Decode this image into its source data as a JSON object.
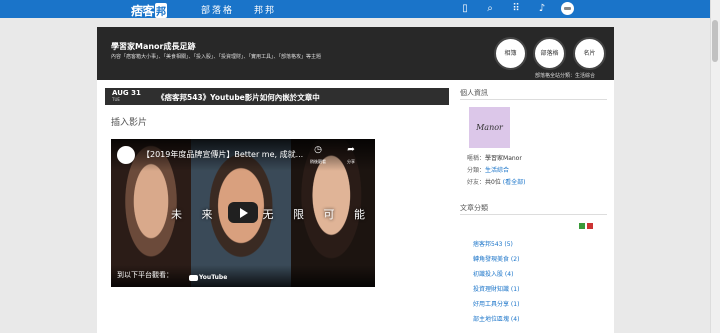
{
  "topbar": {
    "logo_text": "痞客",
    "logo_box": "邦",
    "nav": [
      "部落格",
      "邦邦"
    ]
  },
  "header": {
    "title": "學習家Manor成長足跡",
    "description": "內容「痞客箱大小事」、「美食相關」、「投入股」、「投資理財」、「實用工具」、「部落格攻」等主題",
    "buttons": [
      "相簿",
      "部落格",
      "名片"
    ],
    "category_line": "部落格全站分類：生活綜合"
  },
  "post": {
    "month_day": "AUG 31",
    "weekday": "TUE",
    "title": "《痞客邦543》Youtube影片如何內嵌於文章中",
    "section_heading": "插入影片"
  },
  "video": {
    "title": "【2019年度品牌宣傳片】Better me, 成就...",
    "subtitle": "未 来 我   无 限 可 能",
    "watch_text": "到以下平台觀看：",
    "youtube_label": "YouTube",
    "action_labels": [
      "稍後觀看",
      "分享"
    ]
  },
  "sidebar": {
    "profile_heading": "個人資訊",
    "profile_image_text": "Manor",
    "nickname_label": "暱稱：",
    "nickname": "學習家Manor",
    "category_label": "分類：",
    "category": "生活綜合",
    "friends_label": "好友：",
    "friends_count": "共0位",
    "friends_link": "(看全部)",
    "categories_heading": "文章分類",
    "categories": [
      "痞客邦543 (5)",
      "轉角發現美食 (2)",
      "初識投入股 (4)",
      "投資理財知識 (1)",
      "好用工具分享 (1)",
      "部主地位區塊 (4)"
    ]
  },
  "colors": {
    "topbar": "#1a74c9",
    "header_bg": "#282828",
    "link": "#1a74c9"
  }
}
